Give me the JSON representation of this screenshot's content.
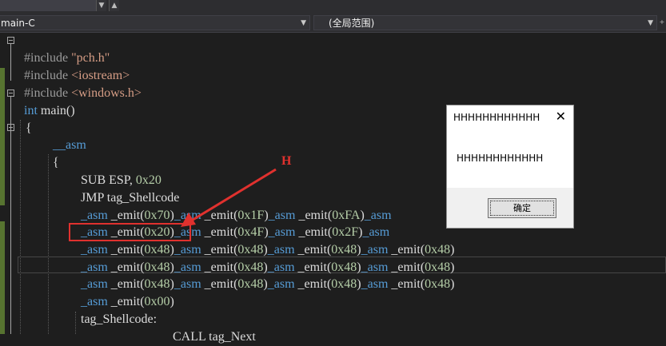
{
  "nav": {
    "scope_left": "main-C",
    "scope_right": "(全局范围)"
  },
  "code_lines": [
    "#include \"pch.h\"",
    "#include <iostream>",
    "#include <windows.h>",
    "int main()",
    "{",
    "__asm",
    "{",
    "SUB ESP, 0x20",
    "JMP tag_Shellcode",
    "_asm _emit(0x70)_asm _emit(0x1F)_asm _emit(0xFA)_asm",
    "_asm _emit(0x20)_asm _emit(0x4F)_asm _emit(0x2F)_asm",
    "_asm _emit(0x48)_asm _emit(0x48)_asm _emit(0x48)_asm _emit(0x48)",
    "_asm _emit(0x48)_asm _emit(0x48)_asm _emit(0x48)_asm _emit(0x48)",
    "_asm _emit(0x48)_asm _emit(0x48)_asm _emit(0x48)_asm _emit(0x48)",
    "_asm _emit(0x00)",
    "tag_Shellcode:",
    "CALL tag_Next"
  ],
  "annotation": {
    "label": "H"
  },
  "dialog": {
    "title": "HHHHHHHHHHHH",
    "message": "HHHHHHHHHHHH",
    "ok_label": "确定"
  },
  "colors": {
    "editor_bg": "#1e1e1e",
    "keyword": "#569cd6",
    "string": "#d69d85",
    "number": "#b5cea8",
    "highlight": "#e0312e",
    "change_bar": "#577430"
  }
}
